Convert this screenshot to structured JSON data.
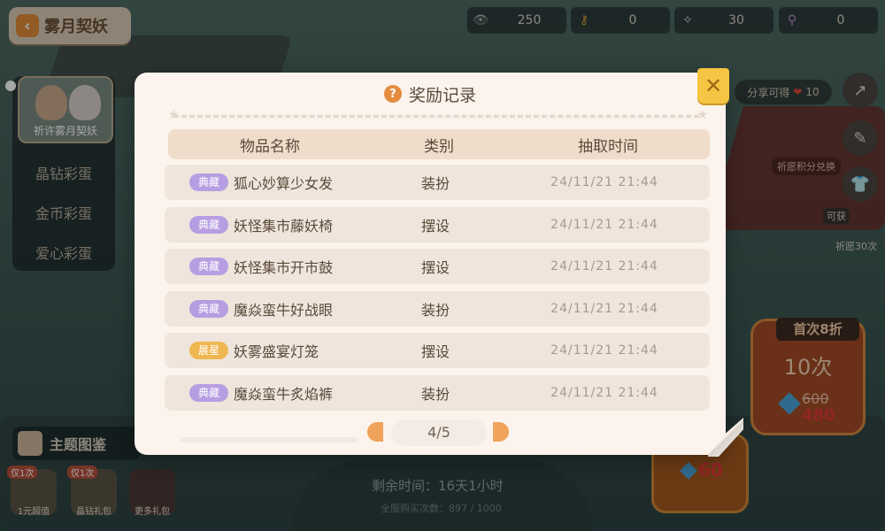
{
  "game": {
    "title": "雾月契妖",
    "currencies": [
      {
        "icon": "eye-icon",
        "value": "250"
      },
      {
        "icon": "key-icon",
        "value": "0"
      },
      {
        "icon": "fairy-icon",
        "value": "30"
      },
      {
        "icon": "wand-icon",
        "value": "0"
      }
    ]
  },
  "left_menu": {
    "pray_label": "祈许雾月契妖",
    "items": [
      "晶钻彩蛋",
      "金币彩蛋",
      "爱心彩蛋"
    ],
    "theme_label": "主题图鉴"
  },
  "bottom_gifts": [
    {
      "tag": "仅1次",
      "label": "1元超值"
    },
    {
      "tag": "仅1次",
      "label": "晶钻礼包"
    },
    {
      "tag": "",
      "label": "更多礼包"
    }
  ],
  "right_panel": {
    "share": "分享可得",
    "share_count": "10",
    "wish_exchange": "祈愿积分兑换",
    "can_get": "可获",
    "wish_count": "祈愿30次",
    "draw_badge": "首次8折",
    "draw_times": "10次",
    "old_price": "600",
    "new_price": "480",
    "single_price": "60"
  },
  "status": {
    "remaining_time": "剩余时间：16天1小时",
    "server_count": "全服购买次数：897 / 1000"
  },
  "modal": {
    "title": "奖励记录",
    "columns": {
      "name": "物品名称",
      "type": "类别",
      "time": "抽取时间"
    },
    "rows": [
      {
        "tag": "典藏",
        "tag_color": "#b79de1",
        "name": "狐心妙算少女发",
        "type": "装扮",
        "time": "24/11/21 21:44"
      },
      {
        "tag": "典藏",
        "tag_color": "#b79de1",
        "name": "妖怪集市藤妖椅",
        "type": "摆设",
        "time": "24/11/21 21:44"
      },
      {
        "tag": "典藏",
        "tag_color": "#b79de1",
        "name": "妖怪集市开市鼓",
        "type": "摆设",
        "time": "24/11/21 21:44"
      },
      {
        "tag": "典藏",
        "tag_color": "#b79de1",
        "name": "魔焱蛮牛好战眼",
        "type": "装扮",
        "time": "24/11/21 21:44"
      },
      {
        "tag": "晨星",
        "tag_color": "#efb752",
        "name": "妖雾盛宴灯笼",
        "type": "摆设",
        "time": "24/11/21 21:44"
      },
      {
        "tag": "典藏",
        "tag_color": "#b79de1",
        "name": "魔焱蛮牛炙焰裤",
        "type": "装扮",
        "time": "24/11/21 21:44"
      }
    ],
    "pager": {
      "current": "4",
      "total": "5",
      "label": "4/5"
    },
    "close": "✕"
  }
}
